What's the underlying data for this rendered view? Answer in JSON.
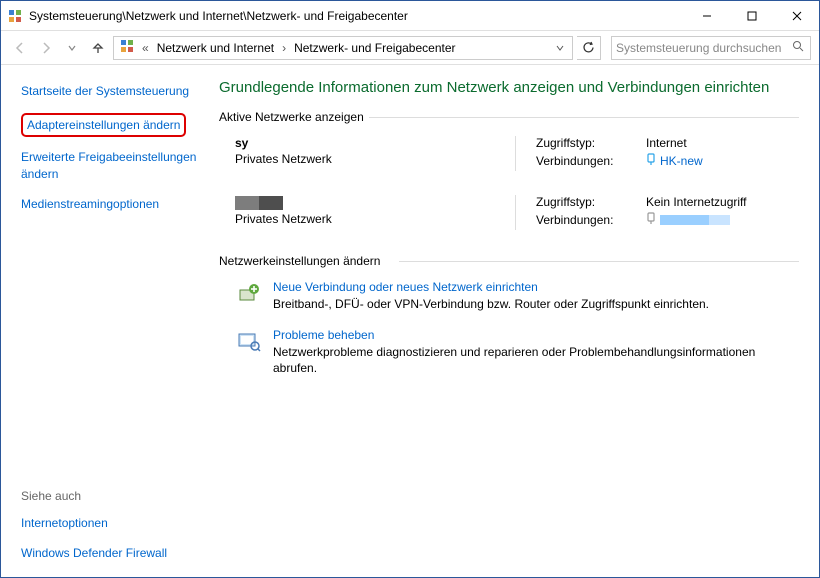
{
  "titlebar": {
    "title": "Systemsteuerung\\Netzwerk und Internet\\Netzwerk- und Freigabecenter"
  },
  "breadcrumb": {
    "level1": "Netzwerk und Internet",
    "level2": "Netzwerk- und Freigabecenter",
    "prefix": "«"
  },
  "search": {
    "placeholder": "Systemsteuerung durchsuchen"
  },
  "sidebar": {
    "items": [
      "Startseite der Systemsteuerung",
      "Adaptereinstellungen ändern",
      "Erweiterte Freigabeeinstellungen ändern",
      "Medienstreamingoptionen"
    ],
    "see_also_header": "Siehe auch",
    "see_also": [
      "Internetoptionen",
      "Windows Defender Firewall"
    ]
  },
  "main": {
    "page_title": "Grundlegende Informationen zum Netzwerk anzeigen und Verbindungen einrichten",
    "active_nets_header": "Aktive Netzwerke anzeigen",
    "net_settings_header": "Netzwerkeinstellungen ändern",
    "networks": [
      {
        "name": "sy",
        "type": "Privates Netzwerk",
        "access_label": "Zugriffstyp:",
        "access_value": "Internet",
        "conn_label": "Verbindungen:",
        "conn_value": "HK-new"
      },
      {
        "name": "",
        "type": "Privates Netzwerk",
        "access_label": "Zugriffstyp:",
        "access_value": "Kein Internetzugriff",
        "conn_label": "Verbindungen:",
        "conn_value": ""
      }
    ],
    "tasks": [
      {
        "title": "Neue Verbindung oder neues Netzwerk einrichten",
        "desc": "Breitband-, DFÜ- oder VPN-Verbindung bzw. Router oder Zugriffspunkt einrichten."
      },
      {
        "title": "Probleme beheben",
        "desc": "Netzwerkprobleme diagnostizieren und reparieren oder Problembehandlungsinformationen abrufen."
      }
    ]
  }
}
